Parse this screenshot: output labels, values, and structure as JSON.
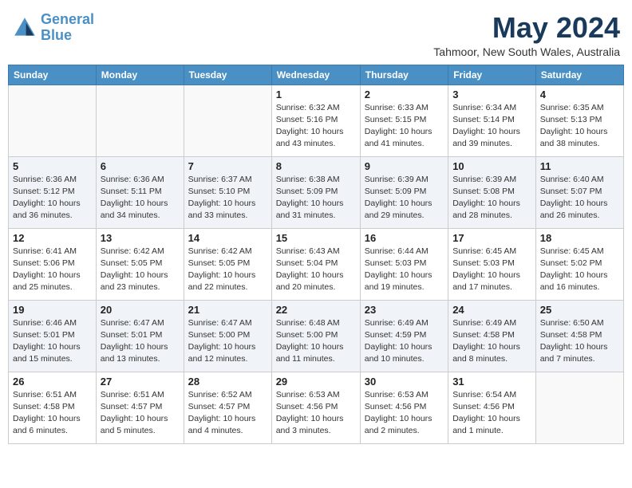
{
  "header": {
    "logo_line1": "General",
    "logo_line2": "Blue",
    "month_year": "May 2024",
    "location": "Tahmoor, New South Wales, Australia"
  },
  "days_of_week": [
    "Sunday",
    "Monday",
    "Tuesday",
    "Wednesday",
    "Thursday",
    "Friday",
    "Saturday"
  ],
  "weeks": [
    [
      {
        "day": "",
        "info": ""
      },
      {
        "day": "",
        "info": ""
      },
      {
        "day": "",
        "info": ""
      },
      {
        "day": "1",
        "info": "Sunrise: 6:32 AM\nSunset: 5:16 PM\nDaylight: 10 hours\nand 43 minutes."
      },
      {
        "day": "2",
        "info": "Sunrise: 6:33 AM\nSunset: 5:15 PM\nDaylight: 10 hours\nand 41 minutes."
      },
      {
        "day": "3",
        "info": "Sunrise: 6:34 AM\nSunset: 5:14 PM\nDaylight: 10 hours\nand 39 minutes."
      },
      {
        "day": "4",
        "info": "Sunrise: 6:35 AM\nSunset: 5:13 PM\nDaylight: 10 hours\nand 38 minutes."
      }
    ],
    [
      {
        "day": "5",
        "info": "Sunrise: 6:36 AM\nSunset: 5:12 PM\nDaylight: 10 hours\nand 36 minutes."
      },
      {
        "day": "6",
        "info": "Sunrise: 6:36 AM\nSunset: 5:11 PM\nDaylight: 10 hours\nand 34 minutes."
      },
      {
        "day": "7",
        "info": "Sunrise: 6:37 AM\nSunset: 5:10 PM\nDaylight: 10 hours\nand 33 minutes."
      },
      {
        "day": "8",
        "info": "Sunrise: 6:38 AM\nSunset: 5:09 PM\nDaylight: 10 hours\nand 31 minutes."
      },
      {
        "day": "9",
        "info": "Sunrise: 6:39 AM\nSunset: 5:09 PM\nDaylight: 10 hours\nand 29 minutes."
      },
      {
        "day": "10",
        "info": "Sunrise: 6:39 AM\nSunset: 5:08 PM\nDaylight: 10 hours\nand 28 minutes."
      },
      {
        "day": "11",
        "info": "Sunrise: 6:40 AM\nSunset: 5:07 PM\nDaylight: 10 hours\nand 26 minutes."
      }
    ],
    [
      {
        "day": "12",
        "info": "Sunrise: 6:41 AM\nSunset: 5:06 PM\nDaylight: 10 hours\nand 25 minutes."
      },
      {
        "day": "13",
        "info": "Sunrise: 6:42 AM\nSunset: 5:05 PM\nDaylight: 10 hours\nand 23 minutes."
      },
      {
        "day": "14",
        "info": "Sunrise: 6:42 AM\nSunset: 5:05 PM\nDaylight: 10 hours\nand 22 minutes."
      },
      {
        "day": "15",
        "info": "Sunrise: 6:43 AM\nSunset: 5:04 PM\nDaylight: 10 hours\nand 20 minutes."
      },
      {
        "day": "16",
        "info": "Sunrise: 6:44 AM\nSunset: 5:03 PM\nDaylight: 10 hours\nand 19 minutes."
      },
      {
        "day": "17",
        "info": "Sunrise: 6:45 AM\nSunset: 5:03 PM\nDaylight: 10 hours\nand 17 minutes."
      },
      {
        "day": "18",
        "info": "Sunrise: 6:45 AM\nSunset: 5:02 PM\nDaylight: 10 hours\nand 16 minutes."
      }
    ],
    [
      {
        "day": "19",
        "info": "Sunrise: 6:46 AM\nSunset: 5:01 PM\nDaylight: 10 hours\nand 15 minutes."
      },
      {
        "day": "20",
        "info": "Sunrise: 6:47 AM\nSunset: 5:01 PM\nDaylight: 10 hours\nand 13 minutes."
      },
      {
        "day": "21",
        "info": "Sunrise: 6:47 AM\nSunset: 5:00 PM\nDaylight: 10 hours\nand 12 minutes."
      },
      {
        "day": "22",
        "info": "Sunrise: 6:48 AM\nSunset: 5:00 PM\nDaylight: 10 hours\nand 11 minutes."
      },
      {
        "day": "23",
        "info": "Sunrise: 6:49 AM\nSunset: 4:59 PM\nDaylight: 10 hours\nand 10 minutes."
      },
      {
        "day": "24",
        "info": "Sunrise: 6:49 AM\nSunset: 4:58 PM\nDaylight: 10 hours\nand 8 minutes."
      },
      {
        "day": "25",
        "info": "Sunrise: 6:50 AM\nSunset: 4:58 PM\nDaylight: 10 hours\nand 7 minutes."
      }
    ],
    [
      {
        "day": "26",
        "info": "Sunrise: 6:51 AM\nSunset: 4:58 PM\nDaylight: 10 hours\nand 6 minutes."
      },
      {
        "day": "27",
        "info": "Sunrise: 6:51 AM\nSunset: 4:57 PM\nDaylight: 10 hours\nand 5 minutes."
      },
      {
        "day": "28",
        "info": "Sunrise: 6:52 AM\nSunset: 4:57 PM\nDaylight: 10 hours\nand 4 minutes."
      },
      {
        "day": "29",
        "info": "Sunrise: 6:53 AM\nSunset: 4:56 PM\nDaylight: 10 hours\nand 3 minutes."
      },
      {
        "day": "30",
        "info": "Sunrise: 6:53 AM\nSunset: 4:56 PM\nDaylight: 10 hours\nand 2 minutes."
      },
      {
        "day": "31",
        "info": "Sunrise: 6:54 AM\nSunset: 4:56 PM\nDaylight: 10 hours\nand 1 minute."
      },
      {
        "day": "",
        "info": ""
      }
    ]
  ]
}
